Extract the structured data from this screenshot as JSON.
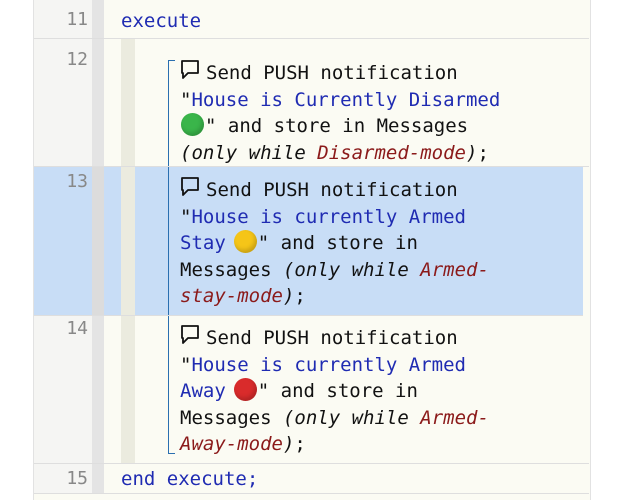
{
  "lines": [
    {
      "num": "11",
      "code": "execute"
    },
    {
      "num": "12"
    },
    {
      "num": "13"
    },
    {
      "num": "14"
    },
    {
      "num": "15",
      "code": "end execute;"
    }
  ],
  "statements": [
    {
      "icon": "comment-icon",
      "action": "Send PUSH notification",
      "quote_open": "\"",
      "message": "House is Currently Disarmed",
      "emoji_color": "#3ab54a",
      "quote_close": "\"",
      "store": " and store in Messages",
      "cond_prefix": "(only while ",
      "mode": "Disarmed-mode",
      "cond_suffix": ")",
      "end": ";"
    },
    {
      "icon": "comment-icon",
      "action": "Send PUSH notification",
      "quote_open": "\"",
      "message": "House is currently Armed Stay",
      "emoji_color": "#f5c518",
      "quote_close": "\"",
      "store": " and store in Messages",
      "cond_prefix": "(only while ",
      "mode": "Armed-stay-mode",
      "cond_suffix": ")",
      "end": ";"
    },
    {
      "icon": "comment-icon",
      "action": "Send PUSH notification",
      "quote_open": "\"",
      "message": "House is currently Armed Away",
      "emoji_color": "#d92b2b",
      "quote_close": "\"",
      "store": " and store in Messages",
      "cond_prefix": "(only while ",
      "mode": "Armed-Away-mode",
      "cond_suffix": ")",
      "end": ";"
    }
  ],
  "colors": {
    "keyword": "#1f2bb2",
    "string": "#1f2bb2",
    "mode": "#8b1a1a",
    "selection": "#c8ddf6",
    "bracket": "#2a6fb0"
  }
}
